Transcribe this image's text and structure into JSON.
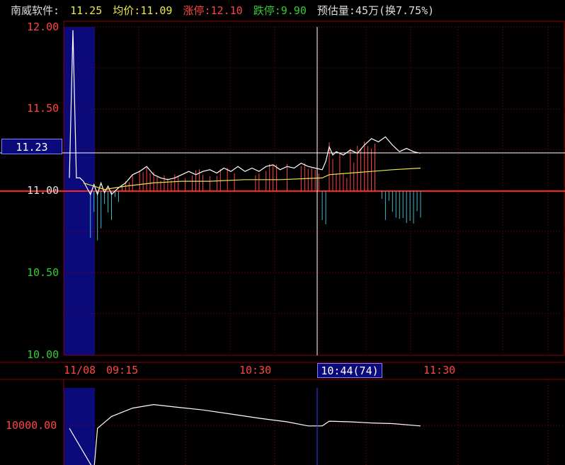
{
  "header": {
    "stock_name": "南威软件:",
    "price": "11.25",
    "avg_label": "均价:",
    "avg_value": "11.09",
    "limit_up_label": "涨停:",
    "limit_up_value": "12.10",
    "limit_down_label": "跌停:",
    "limit_down_value": "9.90",
    "volume_estimate": "预估量:45万(换7.75%)"
  },
  "colors": {
    "up": "#ff4444",
    "down": "#33cc33",
    "yellow": "#e8e84a",
    "white": "#ffffff",
    "grid": "#8b0000",
    "highlight": "#0a0a7a",
    "volume_down": "#3fb8c8"
  },
  "price_axis": {
    "ticks": [
      "12.00",
      "11.50",
      "11.00",
      "10.50",
      "10.00"
    ]
  },
  "crosshair": {
    "price": "11.23",
    "time": "10:44(74)"
  },
  "time_axis": {
    "labels": [
      "11/08",
      "09:15",
      "10:30",
      "11:30"
    ]
  },
  "lower_panel": {
    "label": "10000.00"
  },
  "chart_data": {
    "type": "line",
    "price_range": [
      10.0,
      12.0
    ],
    "prev_close": 11.0,
    "price_series": [
      [
        0,
        11.08
      ],
      [
        1,
        11.98
      ],
      [
        2,
        11.08
      ],
      [
        3,
        11.08
      ],
      [
        4,
        11.06
      ],
      [
        5,
        11.02
      ],
      [
        6,
        10.98
      ],
      [
        7,
        11.04
      ],
      [
        8,
        10.98
      ],
      [
        9,
        11.05
      ],
      [
        10,
        10.99
      ],
      [
        11,
        11.03
      ],
      [
        12,
        10.98
      ],
      [
        14,
        11.02
      ],
      [
        16,
        11.05
      ],
      [
        18,
        11.1
      ],
      [
        20,
        11.12
      ],
      [
        22,
        11.15
      ],
      [
        24,
        11.1
      ],
      [
        26,
        11.08
      ],
      [
        28,
        11.07
      ],
      [
        30,
        11.08
      ],
      [
        32,
        11.1
      ],
      [
        34,
        11.12
      ],
      [
        36,
        11.1
      ],
      [
        38,
        11.12
      ],
      [
        40,
        11.13
      ],
      [
        42,
        11.11
      ],
      [
        44,
        11.14
      ],
      [
        46,
        11.12
      ],
      [
        48,
        11.15
      ],
      [
        50,
        11.12
      ],
      [
        52,
        11.14
      ],
      [
        54,
        11.12
      ],
      [
        56,
        11.15
      ],
      [
        58,
        11.16
      ],
      [
        60,
        11.13
      ],
      [
        62,
        11.15
      ],
      [
        64,
        11.14
      ],
      [
        66,
        11.17
      ],
      [
        68,
        11.15
      ],
      [
        70,
        11.14
      ],
      [
        72,
        11.13
      ],
      [
        73,
        11.18
      ],
      [
        74,
        11.27
      ],
      [
        75,
        11.22
      ],
      [
        76,
        11.24
      ],
      [
        78,
        11.22
      ],
      [
        80,
        11.25
      ],
      [
        82,
        11.23
      ],
      [
        84,
        11.28
      ],
      [
        86,
        11.32
      ],
      [
        88,
        11.3
      ],
      [
        90,
        11.33
      ],
      [
        92,
        11.28
      ],
      [
        94,
        11.24
      ],
      [
        96,
        11.26
      ],
      [
        98,
        11.24
      ],
      [
        100,
        11.23
      ]
    ],
    "avg_series": [
      [
        4,
        11.05
      ],
      [
        10,
        11.01
      ],
      [
        16,
        11.03
      ],
      [
        24,
        11.05
      ],
      [
        32,
        11.06
      ],
      [
        40,
        11.06
      ],
      [
        50,
        11.07
      ],
      [
        60,
        11.07
      ],
      [
        72,
        11.08
      ],
      [
        74,
        11.1
      ],
      [
        80,
        11.11
      ],
      [
        86,
        11.12
      ],
      [
        92,
        11.13
      ],
      [
        100,
        11.14
      ]
    ],
    "volume_series": [
      [
        0,
        9990
      ],
      [
        7,
        9850
      ],
      [
        8,
        9990
      ],
      [
        12,
        10030
      ],
      [
        18,
        10058
      ],
      [
        24,
        10070
      ],
      [
        30,
        10062
      ],
      [
        38,
        10052
      ],
      [
        46,
        10038
      ],
      [
        54,
        10024
      ],
      [
        62,
        10012
      ],
      [
        68,
        9998
      ],
      [
        72,
        9998
      ],
      [
        74,
        10014
      ],
      [
        80,
        10012
      ],
      [
        86,
        10008
      ],
      [
        92,
        10006
      ],
      [
        100,
        9998
      ]
    ]
  }
}
